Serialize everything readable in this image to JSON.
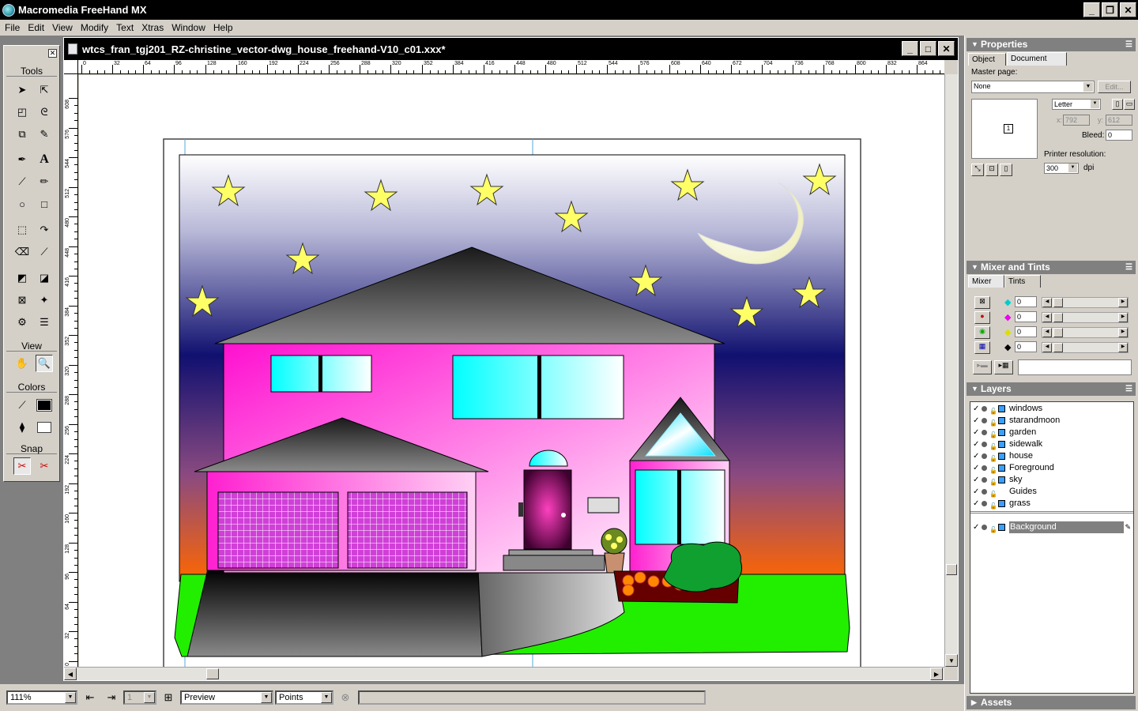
{
  "app": {
    "title": "Macromedia FreeHand MX",
    "menu": [
      "File",
      "Edit",
      "View",
      "Modify",
      "Text",
      "Xtras",
      "Window",
      "Help"
    ]
  },
  "tools": {
    "sections": {
      "tools": "Tools",
      "view": "View",
      "colors": "Colors",
      "snap": "Snap"
    }
  },
  "document": {
    "title": "wtcs_fran_tgj201_RZ-christine_vector-dwg_house_freehand-V10_c01.xxx*",
    "ruler_top": [
      "0",
      "32",
      "64",
      "96",
      "128",
      "160",
      "192",
      "224",
      "256",
      "288",
      "320",
      "352",
      "384",
      "416",
      "448",
      "480",
      "512",
      "544",
      "576",
      "608",
      "640",
      "672",
      "704",
      "736",
      "768",
      "800",
      "832",
      "864"
    ],
    "ruler_left": [
      "608",
      "576",
      "544",
      "512",
      "480",
      "448",
      "416",
      "384",
      "352",
      "320",
      "288",
      "256",
      "224",
      "192",
      "160",
      "128",
      "96",
      "64",
      "32",
      "0"
    ]
  },
  "statusbar": {
    "zoom": "111%",
    "page": "1",
    "view_mode": "Preview",
    "units": "Points"
  },
  "properties": {
    "title": "Properties",
    "tabs": [
      "Object",
      "Document"
    ],
    "master_page_label": "Master page:",
    "master_page_value": "None",
    "edit_button": "Edit...",
    "page_number": "1",
    "page_size": "Letter",
    "x_label": "x:",
    "x_value": "792",
    "y_label": "y:",
    "y_value": "612",
    "bleed_label": "Bleed:",
    "bleed_value": "0",
    "printer_res_label": "Printer resolution:",
    "printer_res_value": "300",
    "dpi_label": "dpi"
  },
  "mixer": {
    "title": "Mixer and Tints",
    "tabs": [
      "Mixer",
      "Tints"
    ],
    "values": [
      "0",
      "0",
      "0",
      "0"
    ]
  },
  "layers": {
    "title": "Layers",
    "items": [
      "windows",
      "starandmoon",
      "garden",
      "sidewalk",
      "house",
      "Foreground",
      "sky",
      "Guides",
      "grass"
    ],
    "background": "Background"
  },
  "assets": {
    "title": "Assets"
  }
}
